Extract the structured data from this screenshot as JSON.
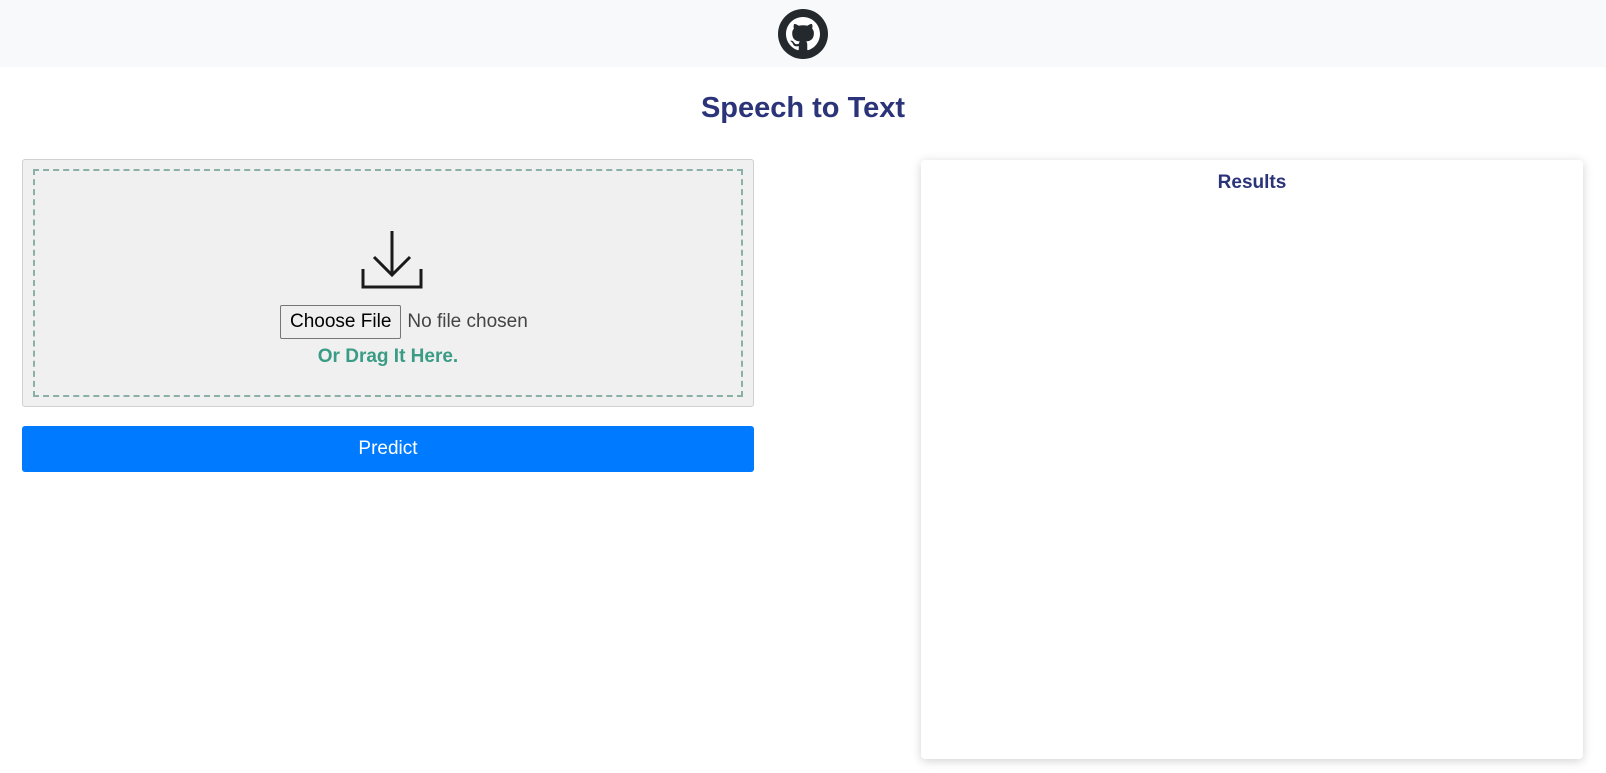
{
  "header": {
    "logo_icon": "github-icon"
  },
  "page": {
    "title": "Speech to Text"
  },
  "upload": {
    "icon": "download-icon",
    "choose_button_label": "Choose File",
    "file_status": "No file chosen",
    "drag_hint": "Or Drag It Here."
  },
  "actions": {
    "predict_label": "Predict"
  },
  "results": {
    "title": "Results"
  },
  "colors": {
    "title": "#2c3479",
    "accent": "#007bff",
    "drag_hint": "#3a9c85",
    "topbar": "#f8f9fa"
  }
}
